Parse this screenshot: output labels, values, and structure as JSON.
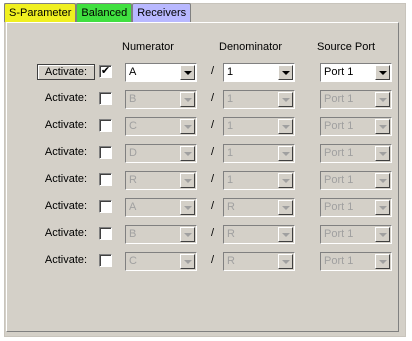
{
  "tabs": [
    {
      "label": "S-Parameter",
      "bg": "#f0f020"
    },
    {
      "label": "Balanced",
      "bg": "#40e040"
    },
    {
      "label": "Receivers",
      "bg": "#b8b8ff"
    }
  ],
  "headers": {
    "numerator": "Numerator",
    "denominator": "Denominator",
    "source_port": "Source Port"
  },
  "slash": "/",
  "activate_label": "Activate:",
  "rows": [
    {
      "checked": true,
      "enabled": true,
      "numerator": "A",
      "denominator": "1",
      "source": "Port 1"
    },
    {
      "checked": false,
      "enabled": false,
      "numerator": "B",
      "denominator": "1",
      "source": "Port 1"
    },
    {
      "checked": false,
      "enabled": false,
      "numerator": "C",
      "denominator": "1",
      "source": "Port 1"
    },
    {
      "checked": false,
      "enabled": false,
      "numerator": "D",
      "denominator": "1",
      "source": "Port 1"
    },
    {
      "checked": false,
      "enabled": false,
      "numerator": "R",
      "denominator": "1",
      "source": "Port 1"
    },
    {
      "checked": false,
      "enabled": false,
      "numerator": "A",
      "denominator": "R",
      "source": "Port 1"
    },
    {
      "checked": false,
      "enabled": false,
      "numerator": "B",
      "denominator": "R",
      "source": "Port 1"
    },
    {
      "checked": false,
      "enabled": false,
      "numerator": "C",
      "denominator": "R",
      "source": "Port 1"
    }
  ]
}
